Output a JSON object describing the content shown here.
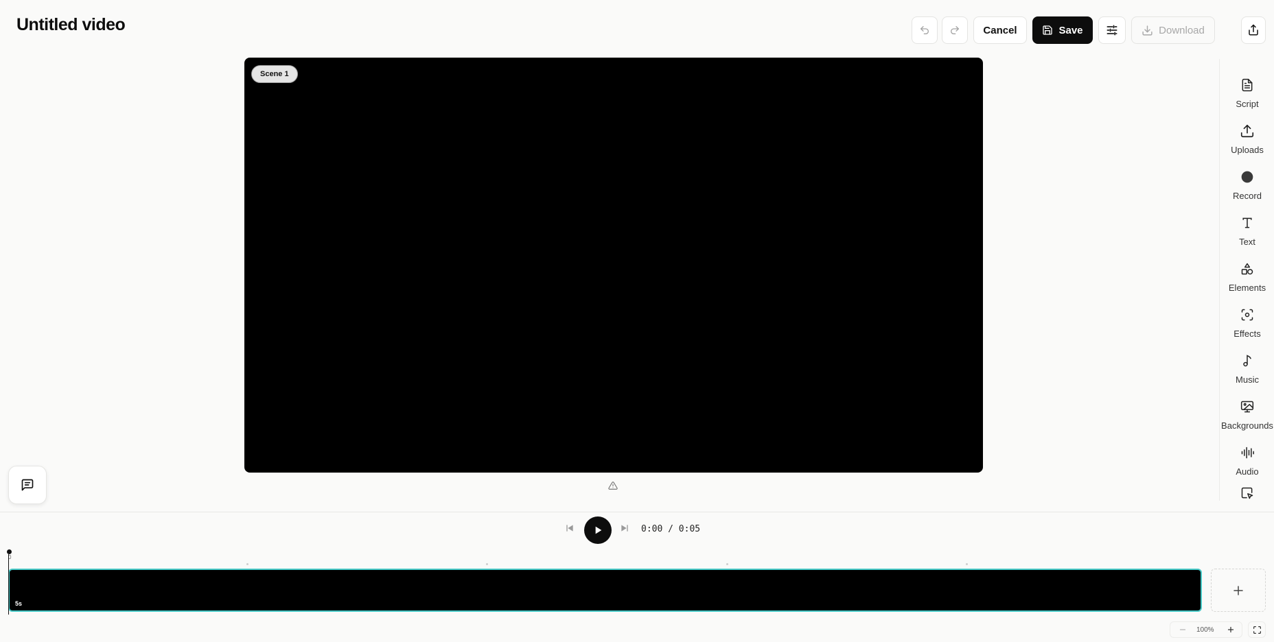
{
  "app": {
    "title": "Untitled video"
  },
  "toolbar": {
    "undo_icon": "undo-icon",
    "redo_icon": "redo-icon",
    "cancel_label": "Cancel",
    "save_label": "Save",
    "settings_icon": "sliders-icon",
    "download_label": "Download",
    "share_icon": "share-icon",
    "accent": "#0d0d0d"
  },
  "preview": {
    "scene_label": "Scene 1",
    "background": "#000000"
  },
  "sidebar": {
    "items": [
      {
        "label": "Script",
        "icon": "document-icon"
      },
      {
        "label": "Uploads",
        "icon": "upload-icon"
      },
      {
        "label": "Record",
        "icon": "record-icon"
      },
      {
        "label": "Text",
        "icon": "text-icon"
      },
      {
        "label": "Elements",
        "icon": "shapes-icon"
      },
      {
        "label": "Effects",
        "icon": "effects-icon"
      },
      {
        "label": "Music",
        "icon": "music-note-icon"
      },
      {
        "label": "Backgrounds",
        "icon": "background-image-icon"
      },
      {
        "label": "Audio",
        "icon": "audio-wave-icon"
      },
      {
        "label": "",
        "icon": "cursor-select-icon"
      }
    ]
  },
  "player": {
    "time": "0:00 / 0:05"
  },
  "timeline": {
    "playhead_label": "0",
    "clip_duration": "5s",
    "clip_border_color": "#46c9c7"
  },
  "zoom": {
    "level": "100%"
  }
}
